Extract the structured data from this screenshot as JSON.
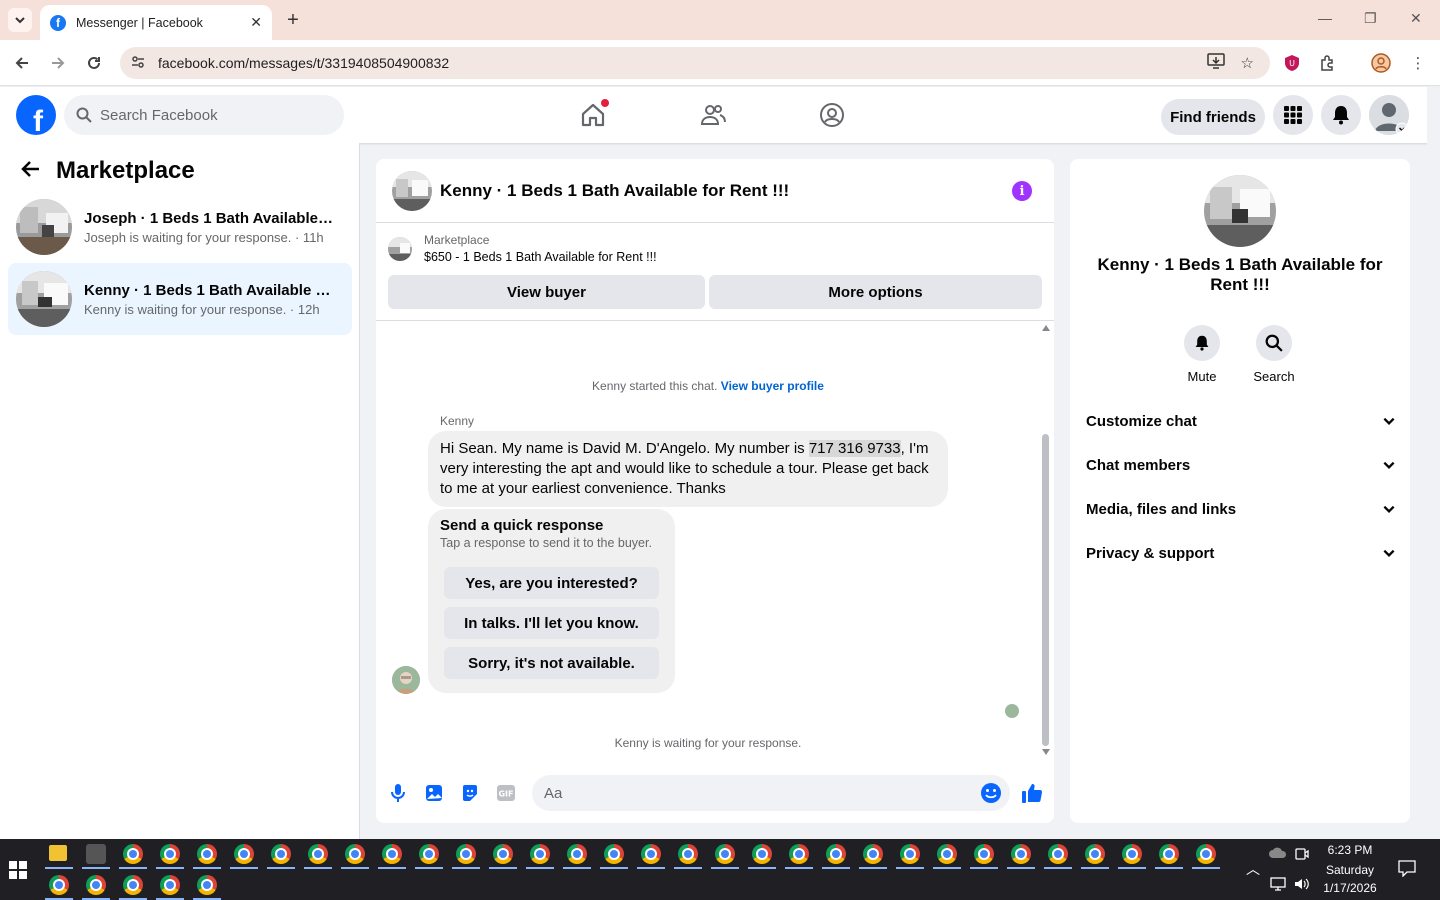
{
  "browser": {
    "tab_title": "Messenger | Facebook",
    "url": "facebook.com/messages/t/3319408504900832"
  },
  "fb": {
    "search_placeholder": "Search Facebook",
    "find_friends": "Find friends"
  },
  "sidebar": {
    "title": "Marketplace",
    "conversations": [
      {
        "title": "Joseph · 1 Beds 1 Bath Available for Rent !!!",
        "subtitle": "Joseph is waiting for your response. · 11h"
      },
      {
        "title": "Kenny · 1 Beds 1 Bath Available for Rent !!!",
        "subtitle": "Kenny is waiting for your response. · 12h"
      }
    ]
  },
  "chat": {
    "title": "Kenny · 1 Beds 1 Bath Available for Rent !!!",
    "listing_source": "Marketplace",
    "listing_title": "$650 - 1 Beds 1 Bath Available for Rent !!!",
    "view_buyer": "View buyer",
    "more_options": "More options",
    "started_text": "Kenny started this chat.",
    "view_buyer_profile": "View buyer profile",
    "sender_name": "Kenny",
    "message_pre": "Hi Sean. My name is David M. D'Angelo.  My number is ",
    "message_phone": "717 316 9733",
    "message_post": ", I'm very interesting the apt and would like to schedule a tour. Please get back to me at your earliest convenience. Thanks",
    "quick_title": "Send a quick response",
    "quick_sub": "Tap a response to send it to the buyer.",
    "quick_options": [
      "Yes, are you interested?",
      "In talks. I'll let you know.",
      "Sorry, it's not available."
    ],
    "waiting_text": "Kenny is waiting for your response.",
    "input_placeholder": "Aa"
  },
  "details": {
    "name": "Kenny · 1 Beds 1 Bath Available for Rent !!!",
    "mute": "Mute",
    "search": "Search",
    "sections": [
      "Customize chat",
      "Chat members",
      "Media, files and links",
      "Privacy & support"
    ]
  },
  "taskbar": {
    "time": "6:23 PM",
    "day": "Saturday",
    "date": "1/17/2026"
  },
  "colors": {
    "fb_blue": "#0866ff",
    "active_conv": "#ebf5ff",
    "link": "#0064d1",
    "info": "#a033ff"
  }
}
